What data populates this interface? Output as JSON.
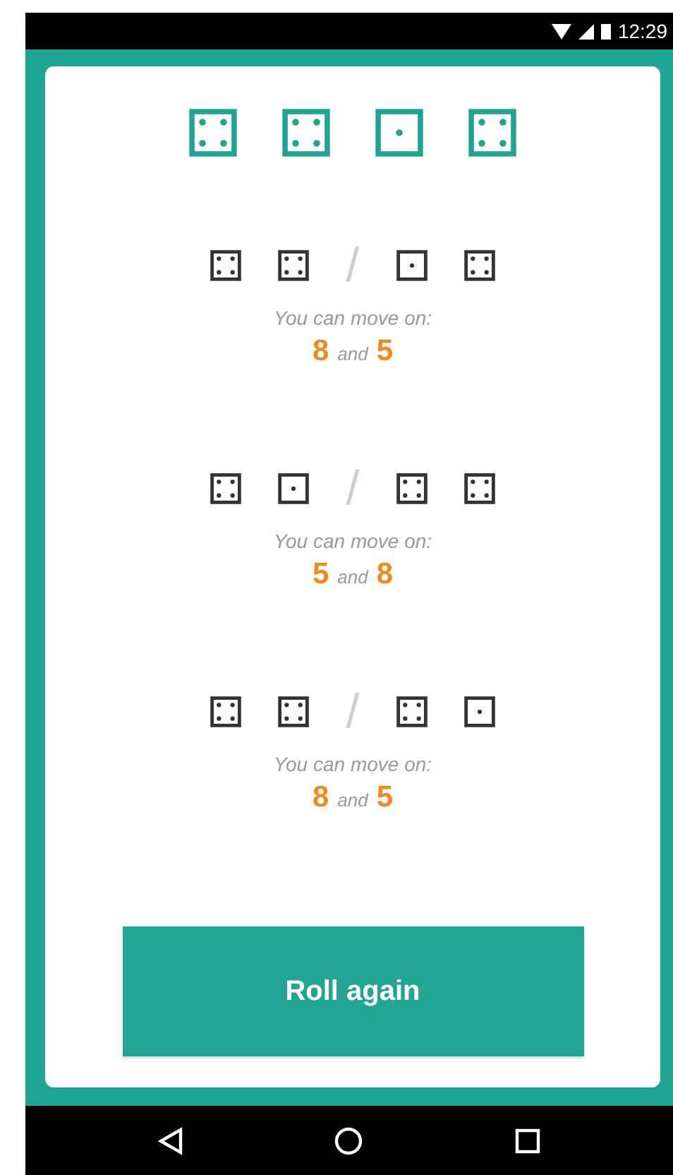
{
  "status_bar": {
    "time": "12:29"
  },
  "rolled_dice": [
    {
      "kind": "four"
    },
    {
      "kind": "four"
    },
    {
      "kind": "one"
    },
    {
      "kind": "four"
    }
  ],
  "combinations": [
    {
      "first_pair": [
        {
          "kind": "four"
        },
        {
          "kind": "four"
        }
      ],
      "separator": "/",
      "second_pair": [
        {
          "kind": "one"
        },
        {
          "kind": "four"
        }
      ],
      "caption": "You can move on:",
      "first_total": "8",
      "conjunction": "and",
      "second_total": "5"
    },
    {
      "first_pair": [
        {
          "kind": "four"
        },
        {
          "kind": "one"
        }
      ],
      "separator": "/",
      "second_pair": [
        {
          "kind": "four"
        },
        {
          "kind": "four"
        }
      ],
      "caption": "You can move on:",
      "first_total": "5",
      "conjunction": "and",
      "second_total": "8"
    },
    {
      "first_pair": [
        {
          "kind": "four"
        },
        {
          "kind": "four"
        }
      ],
      "separator": "/",
      "second_pair": [
        {
          "kind": "four"
        },
        {
          "kind": "one"
        }
      ],
      "caption": "You can move on:",
      "first_total": "8",
      "conjunction": "and",
      "second_total": "5"
    }
  ],
  "button": "Roll again"
}
